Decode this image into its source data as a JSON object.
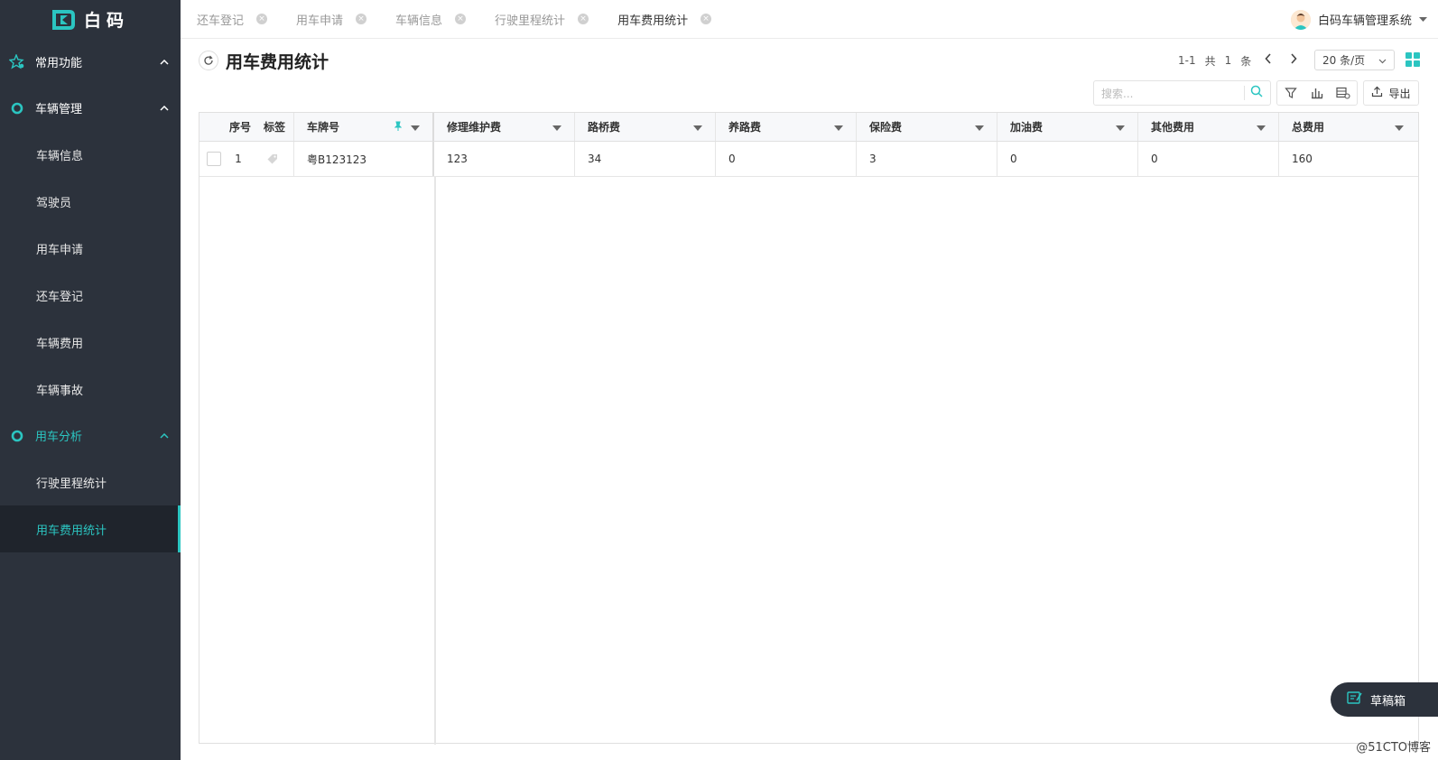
{
  "brand": {
    "name": "白码",
    "accent": "#2bc5c1",
    "sidebar_bg": "#2c323c"
  },
  "sidebar": {
    "groups": [
      {
        "label": "常用功能",
        "icon": "star-gear-icon",
        "expanded": true,
        "items": []
      },
      {
        "label": "车辆管理",
        "icon": "circle-icon",
        "expanded": true,
        "items": [
          "车辆信息",
          "驾驶员",
          "用车申请",
          "还车登记",
          "车辆费用",
          "车辆事故"
        ]
      },
      {
        "label": "用车分析",
        "icon": "circle-icon",
        "expanded": true,
        "active": true,
        "items": [
          "行驶里程统计",
          "用车费用统计"
        ]
      }
    ],
    "active_item": "用车费用统计"
  },
  "tabs": [
    {
      "label": "还车登记"
    },
    {
      "label": "用车申请"
    },
    {
      "label": "车辆信息"
    },
    {
      "label": "行驶里程统计"
    },
    {
      "label": "用车费用统计",
      "current": true
    }
  ],
  "user": {
    "name": "白码车辆管理系统"
  },
  "page": {
    "title": "用车费用统计"
  },
  "pager": {
    "range": "1-1",
    "total_label": "共",
    "total": "1",
    "unit": "条",
    "page_size": "20 条/页"
  },
  "toolbar": {
    "search_placeholder": "搜索...",
    "export_label": "导出"
  },
  "table": {
    "columns": [
      "序号",
      "标签",
      "车牌号",
      "修理维护费",
      "路桥费",
      "养路费",
      "保险费",
      "加油费",
      "其他费用",
      "总费用"
    ],
    "rows": [
      {
        "index": "1",
        "plate": "粤B123123",
        "repair": "123",
        "toll": "34",
        "road": "0",
        "insurance": "3",
        "fuel": "0",
        "other": "0",
        "total": "160"
      }
    ]
  },
  "drafts": {
    "label": "草稿箱"
  },
  "watermark": "@51CTO博客"
}
